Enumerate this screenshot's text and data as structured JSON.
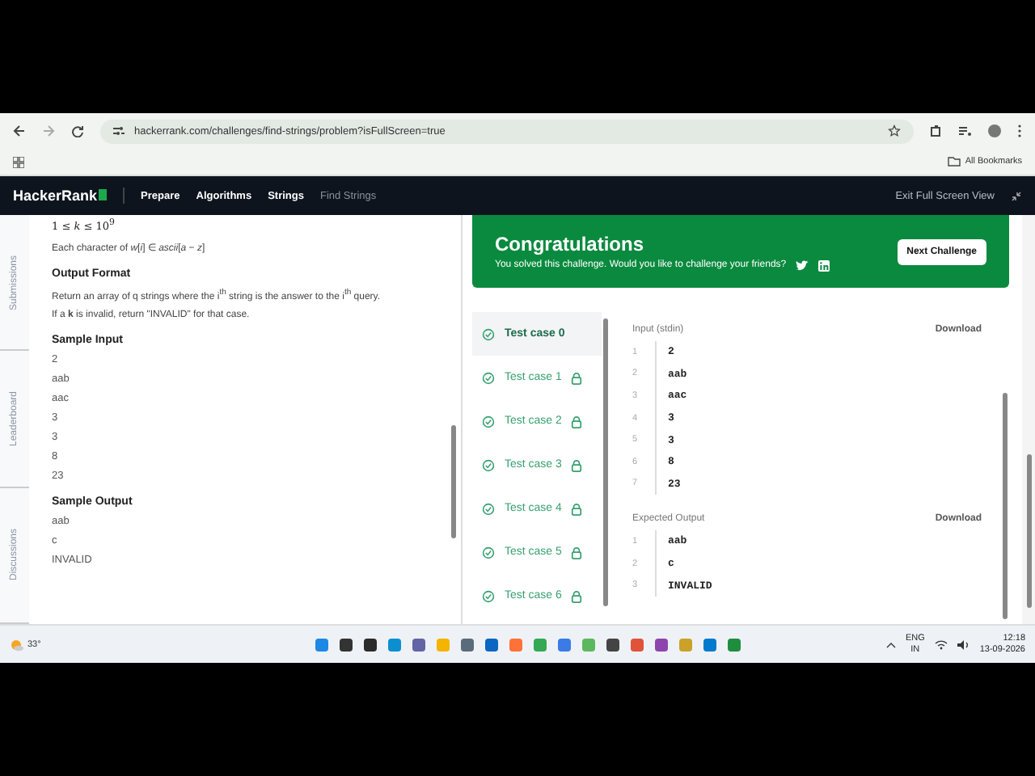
{
  "browser": {
    "url": "hackerrank.com/challenges/find-strings/problem?isFullScreen=true",
    "bookmarks": "All Bookmarks"
  },
  "nav": {
    "logo": "HackerRank",
    "breadcrumbs": [
      {
        "label": "Prepare",
        "current": false
      },
      {
        "label": "Algorithms",
        "current": false
      },
      {
        "label": "Strings",
        "current": false
      },
      {
        "label": "Find Strings",
        "current": true
      }
    ],
    "exit": "Exit Full Screen View"
  },
  "side_tabs": [
    "Submissions",
    "Leaderboard",
    "Discussions"
  ],
  "problem": [
    {
      "kind": "math",
      "text": "1 ≤ *k* ≤ 10$^{9}$"
    },
    {
      "kind": "text",
      "text": "Each character of *w*[*i*] ∈ *ascii*[*a* − *z*]"
    },
    {
      "kind": "heading",
      "text": "Output Format"
    },
    {
      "kind": "text",
      "text": "Return an array of q strings where the i$^{th}$ string is the answer to the i$^{th}$ query."
    },
    {
      "kind": "text",
      "text": "If a **k** is invalid, return \"INVALID\" for that case."
    },
    {
      "kind": "heading",
      "text": "Sample Input"
    },
    {
      "kind": "line",
      "text": "2"
    },
    {
      "kind": "line",
      "text": "aab"
    },
    {
      "kind": "line",
      "text": "aac"
    },
    {
      "kind": "line",
      "text": "3"
    },
    {
      "kind": "line",
      "text": "3"
    },
    {
      "kind": "line",
      "text": "8"
    },
    {
      "kind": "line",
      "text": "23"
    },
    {
      "kind": "heading",
      "text": "Sample Output"
    },
    {
      "kind": "line",
      "text": "aab"
    },
    {
      "kind": "line",
      "text": "c"
    },
    {
      "kind": "line",
      "text": "INVALID"
    }
  ],
  "banner": {
    "title": "Congratulations",
    "message": "You solved this challenge. Would you like to challenge your friends?",
    "button": "Next Challenge"
  },
  "test_cases": [
    {
      "label": "Test case 0",
      "selected": true,
      "locked": false
    },
    {
      "label": "Test case 1",
      "selected": false,
      "locked": true
    },
    {
      "label": "Test case 2",
      "selected": false,
      "locked": true
    },
    {
      "label": "Test case 3",
      "selected": false,
      "locked": true
    },
    {
      "label": "Test case 4",
      "selected": false,
      "locked": true
    },
    {
      "label": "Test case 5",
      "selected": false,
      "locked": true
    },
    {
      "label": "Test case 6",
      "selected": false,
      "locked": true
    }
  ],
  "io": [
    {
      "label": "Input (stdin)",
      "download": "Download",
      "lines": [
        {
          "n": "1",
          "text": "2"
        },
        {
          "n": "2",
          "text": "aab"
        },
        {
          "n": "3",
          "text": "aac"
        },
        {
          "n": "4",
          "text": "3"
        },
        {
          "n": "5",
          "text": "3"
        },
        {
          "n": "6",
          "text": "8"
        },
        {
          "n": "7",
          "text": "23"
        }
      ]
    },
    {
      "label": "Expected Output",
      "download": "Download",
      "lines": [
        {
          "n": "1",
          "text": "aab"
        },
        {
          "n": "2",
          "text": "c"
        },
        {
          "n": "3",
          "text": "INVALID"
        }
      ]
    }
  ],
  "taskbar": {
    "weather": "33°",
    "lang": "ENG",
    "region": "IN",
    "time": "12:18",
    "date": "13-09-2026"
  }
}
